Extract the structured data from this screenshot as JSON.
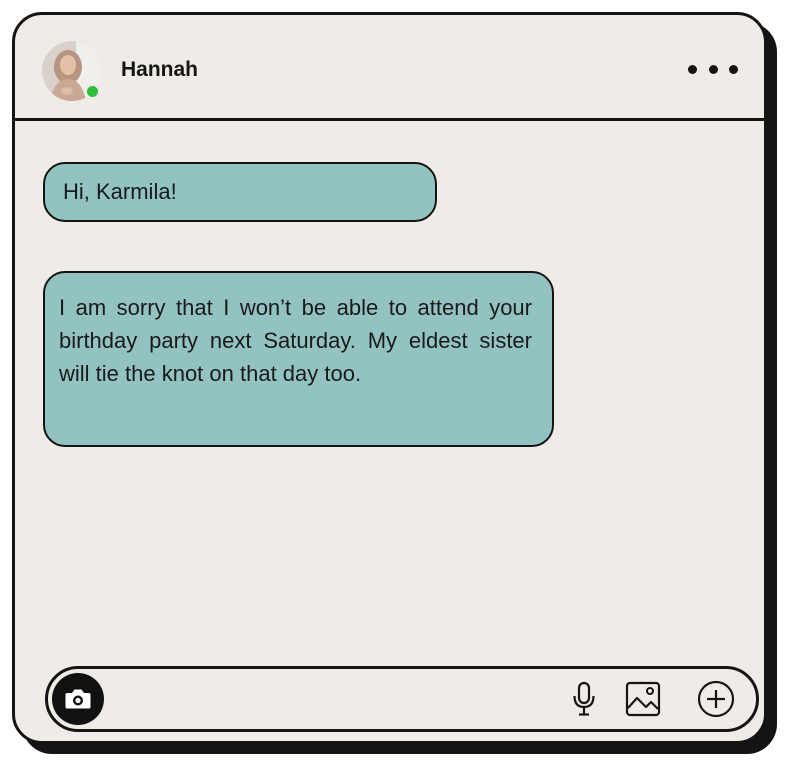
{
  "header": {
    "contact_name": "Hannah",
    "status": "online",
    "status_color": "#2fbf3a"
  },
  "messages": [
    {
      "text": "Hi, Karmila!"
    },
    {
      "text": "I am sorry that I won’t be able to attend your birthday party next Saturday. My eldest sister will tie the knot on that day too."
    }
  ],
  "input_bar": {
    "value": "",
    "placeholder": "",
    "icons": [
      "camera-icon",
      "microphone-icon",
      "image-icon",
      "plus-circle-icon"
    ]
  },
  "colors": {
    "bubble": "#93c3c1",
    "background": "#efece7",
    "outline": "#141414"
  }
}
